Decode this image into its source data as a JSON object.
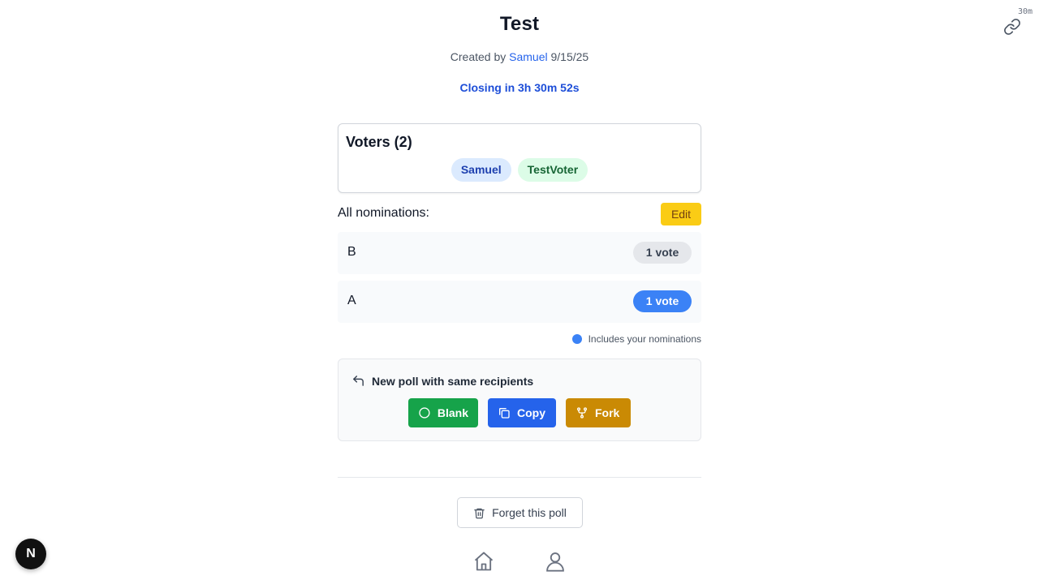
{
  "corner_badge": "30m",
  "poll": {
    "title": "Test",
    "created_prefix": "Created by",
    "author": "Samuel",
    "date": "9/15/25",
    "closing": "Closing in 3h 30m 52s"
  },
  "voters": {
    "title": "Voters (2)",
    "list": [
      "Samuel",
      "TestVoter"
    ]
  },
  "nominations": {
    "label": "All nominations:",
    "edit_label": "Edit",
    "items": [
      {
        "name": "B",
        "votes": "1 vote",
        "yours": false
      },
      {
        "name": "A",
        "votes": "1 vote",
        "yours": true
      }
    ],
    "legend": "Includes your nominations"
  },
  "new_poll": {
    "title": "New poll with same recipients",
    "buttons": {
      "blank": "Blank",
      "copy": "Copy",
      "fork": "Fork"
    }
  },
  "forget_label": "Forget this poll",
  "next_badge": "N",
  "colors": {
    "accent_blue": "#2563eb",
    "closing_blue": "#1d4ed8",
    "edit_yellow": "#facc15",
    "blank_green": "#16a34a",
    "fork_amber": "#ca8a04",
    "your_vote_blue": "#3b82f6"
  },
  "icons": {
    "share": "link-icon",
    "reply": "reply-arrow-icon",
    "blank": "circle-icon",
    "copy": "copy-icon",
    "fork": "git-fork-icon",
    "forget": "trash-icon",
    "home": "home-icon",
    "profile": "user-icon"
  }
}
